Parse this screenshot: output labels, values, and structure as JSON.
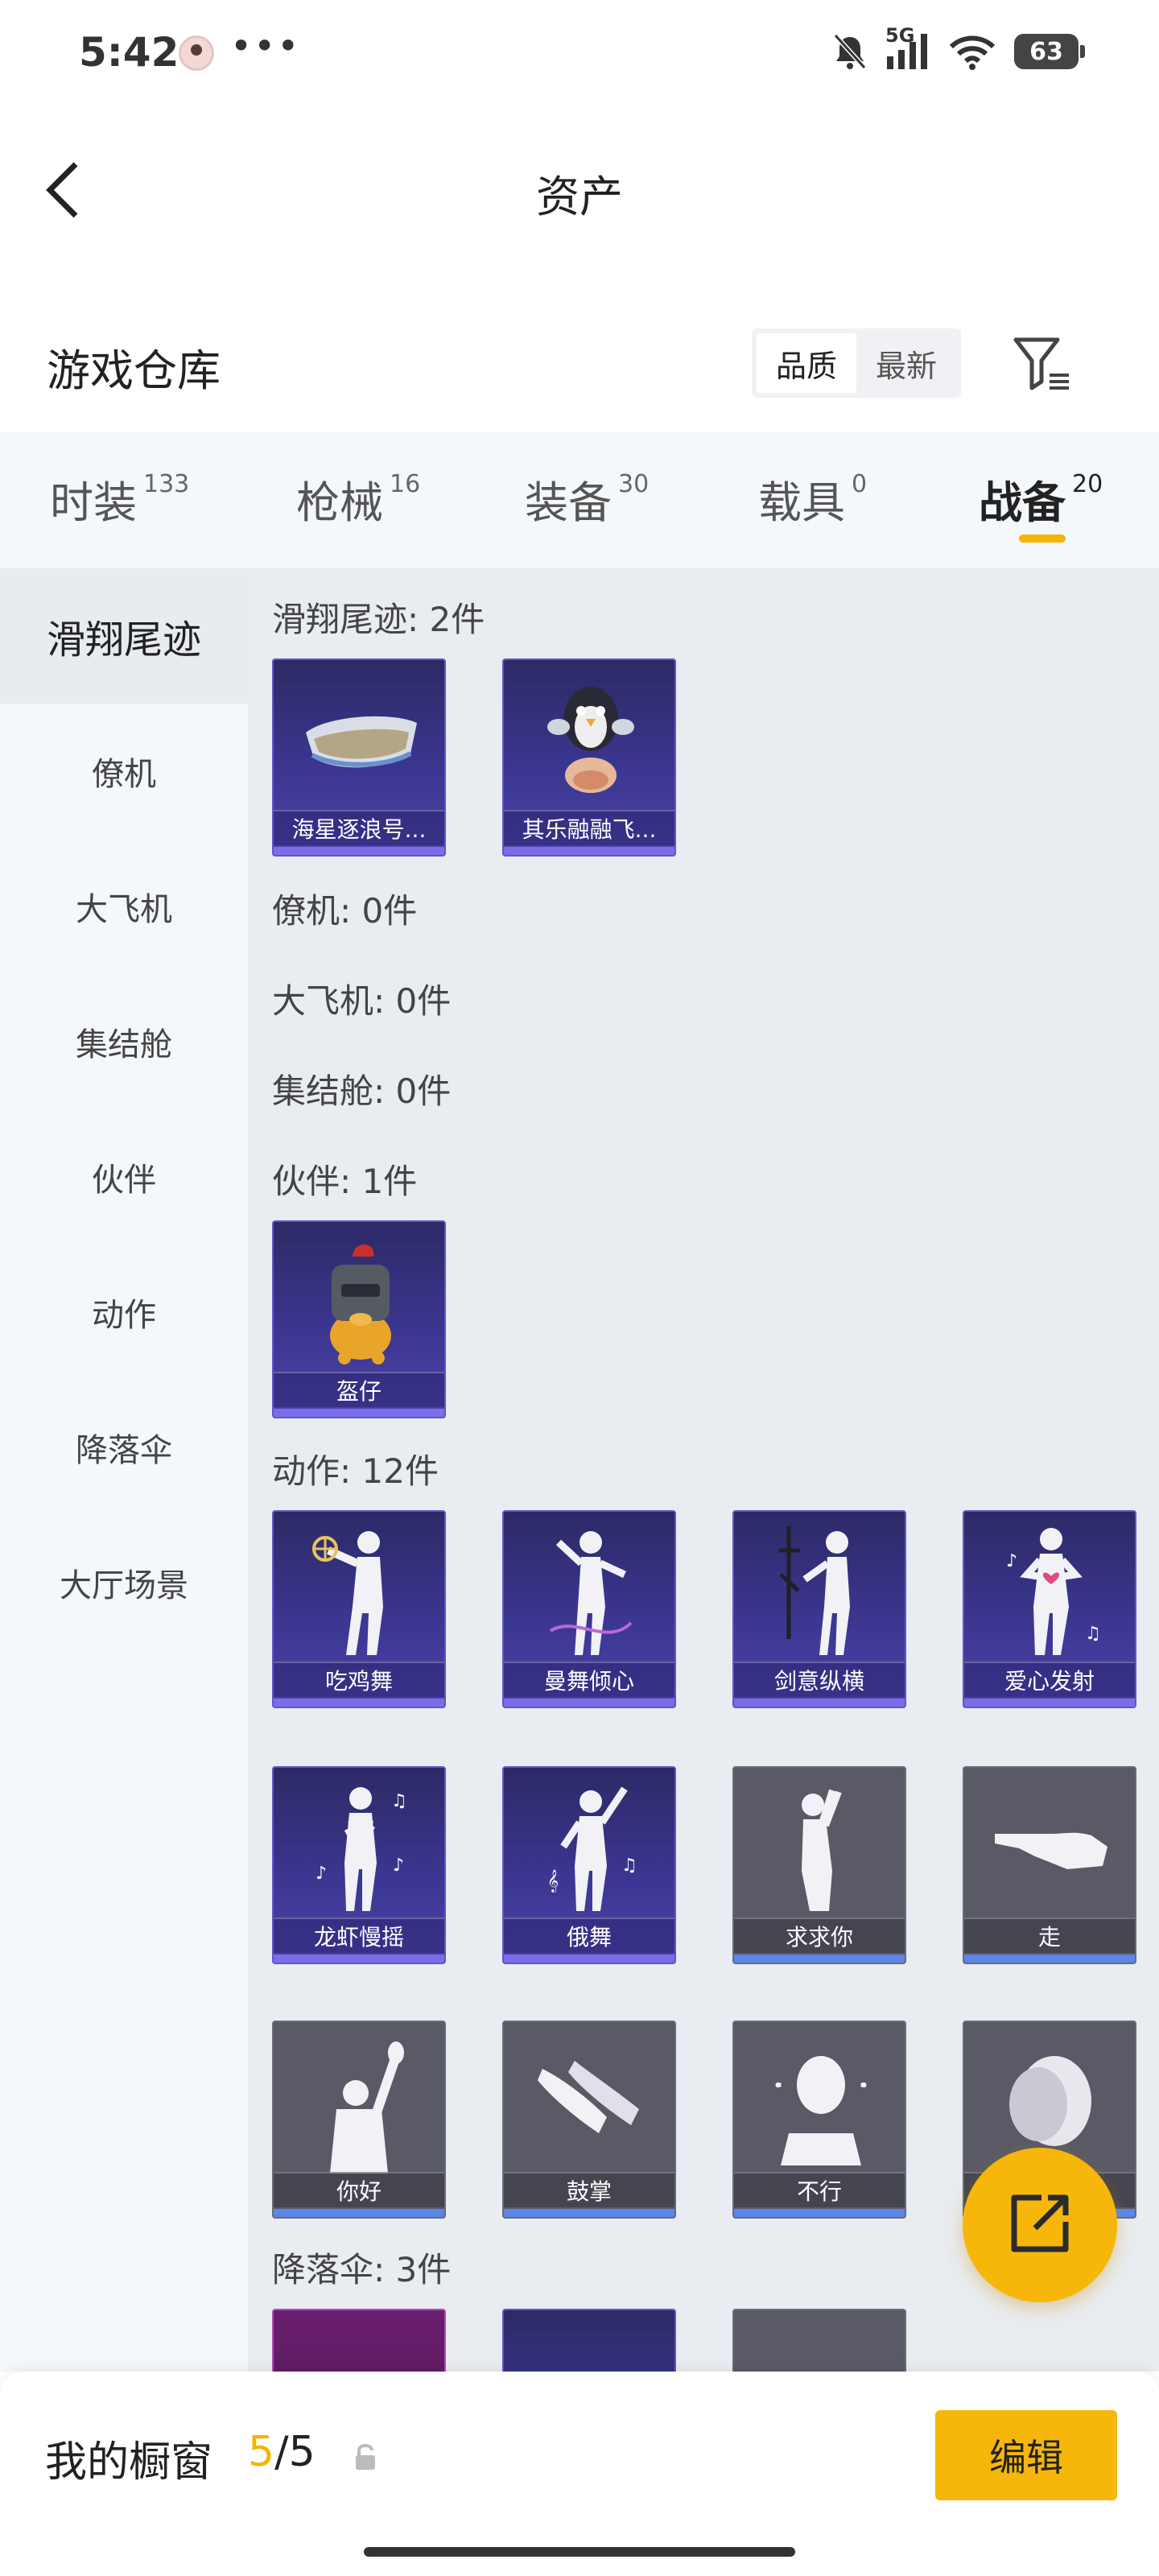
{
  "status_bar": {
    "time": "5:42",
    "dots": "•••",
    "network": "5G",
    "battery": "63"
  },
  "nav": {
    "title": "资产"
  },
  "section": {
    "title": "游戏仓库",
    "sort_quality": "品质",
    "sort_newest": "最新"
  },
  "tabs": [
    {
      "label": "时装",
      "count": "133"
    },
    {
      "label": "枪械",
      "count": "16"
    },
    {
      "label": "装备",
      "count": "30"
    },
    {
      "label": "载具",
      "count": "0"
    },
    {
      "label": "战备",
      "count": "20"
    }
  ],
  "active_tab": "战备",
  "sidebar": {
    "items": [
      {
        "label": "滑翔尾迹"
      },
      {
        "label": "僚机"
      },
      {
        "label": "大飞机"
      },
      {
        "label": "集结舱"
      },
      {
        "label": "伙伴"
      },
      {
        "label": "动作"
      },
      {
        "label": "降落伞"
      },
      {
        "label": "大厅场景"
      }
    ]
  },
  "groups": {
    "glide": {
      "title": "滑翔尾迹: 2件",
      "items": [
        "海星逐浪号...",
        "其乐融融飞..."
      ]
    },
    "wingman": {
      "title": "僚机: 0件"
    },
    "plane": {
      "title": "大飞机: 0件"
    },
    "pod": {
      "title": "集结舱: 0件"
    },
    "partner": {
      "title": "伙伴: 1件",
      "items": [
        "盔仔"
      ]
    },
    "emote": {
      "title": "动作: 12件",
      "items": [
        "吃鸡舞",
        "曼舞倾心",
        "剑意纵横",
        "爱心发射",
        "龙虾慢摇",
        "俄舞",
        "求求你",
        "走",
        "你好",
        "鼓掌",
        "不行",
        ""
      ]
    },
    "parachute": {
      "title": "降落伞: 3件"
    }
  },
  "bottom": {
    "label": "我的橱窗",
    "current": "5",
    "total": "/5",
    "edit": "编辑"
  },
  "colors": {
    "accent": "#f6b60a",
    "card_purple": "#3b3690",
    "card_grey": "#5a5a66"
  }
}
